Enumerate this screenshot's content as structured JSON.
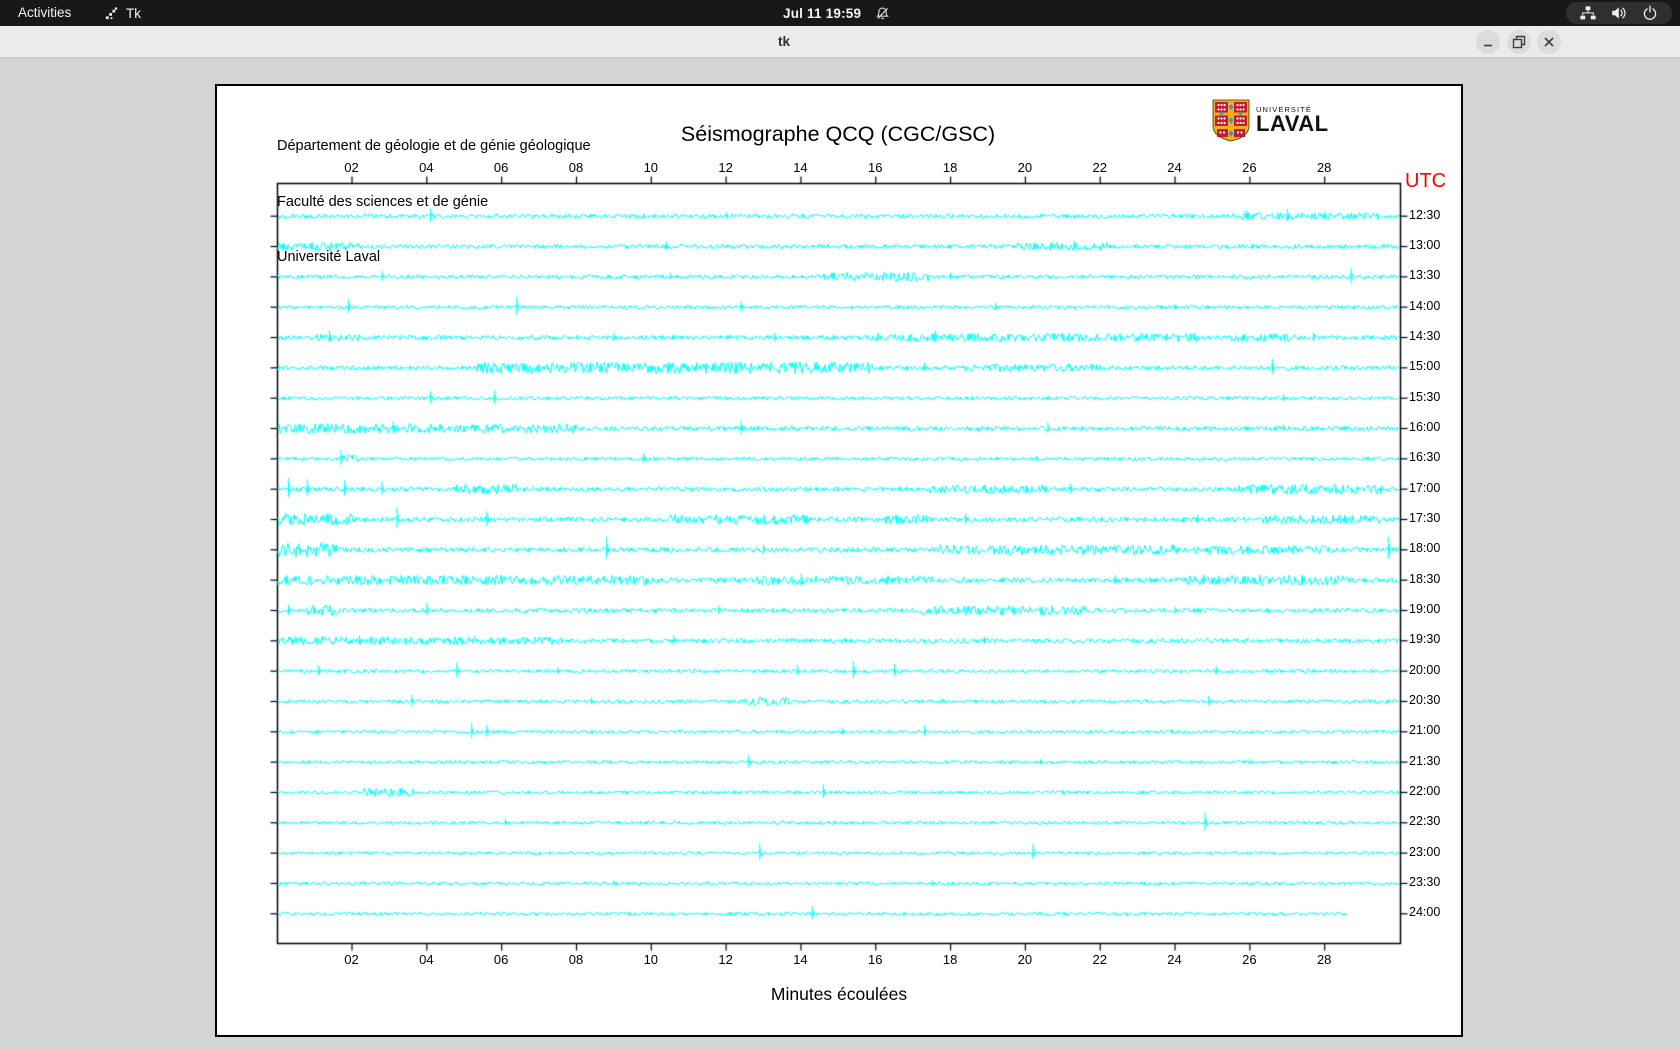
{
  "topbar": {
    "activities": "Activities",
    "app_name": "Tk",
    "clock": "Jul 11 19:59",
    "icons": [
      "tk-icon",
      "notifications-muted-icon",
      "network-wired-icon",
      "volume-icon",
      "power-icon"
    ]
  },
  "titlebar": {
    "title": "tk",
    "buttons": [
      "minimize",
      "maximize",
      "close"
    ]
  },
  "document": {
    "header_lines": [
      "Département de géologie et de génie géologique",
      "Faculté des sciences et de génie",
      "Université Laval"
    ],
    "title": "Séismographe QCQ (CGC/GSC)",
    "utc": "UTC",
    "xlabel": "Minutes écoulées",
    "logo": {
      "line1": "UNIVERSITÉ",
      "line2": "LAVAL"
    }
  },
  "chart_data": {
    "type": "line",
    "subtype": "helicorder-seismograph",
    "title": "Séismographe QCQ (CGC/GSC)",
    "xlabel": "Minutes écoulées",
    "x_range_minutes": [
      0,
      30
    ],
    "x_ticks": [
      "02",
      "04",
      "06",
      "08",
      "10",
      "12",
      "14",
      "16",
      "18",
      "20",
      "22",
      "24",
      "26",
      "28"
    ],
    "ylabel_right": "UTC",
    "trace_color": "#00ffff",
    "axis_color": "#000000",
    "utc_color": "#ff0000",
    "grid": false,
    "rows": [
      {
        "label": "12:30",
        "base": 2.2,
        "end": 30,
        "bursts": [
          [
            25.5,
            29.5,
            1.6
          ]
        ],
        "spikes": [
          [
            4.1,
            8
          ],
          [
            12.0,
            4
          ],
          [
            25.9,
            6
          ],
          [
            27.0,
            7
          ],
          [
            28.0,
            5
          ]
        ]
      },
      {
        "label": "13:00",
        "base": 2.2,
        "end": 30,
        "bursts": [
          [
            0,
            2.2,
            2.0
          ],
          [
            19.8,
            22.2,
            1.9
          ]
        ],
        "spikes": [
          [
            10.4,
            5
          ],
          [
            21.3,
            6
          ]
        ]
      },
      {
        "label": "13:30",
        "base": 2.0,
        "end": 30,
        "bursts": [
          [
            14.6,
            17.4,
            2.3
          ]
        ],
        "spikes": [
          [
            2.8,
            6
          ],
          [
            10.5,
            4
          ],
          [
            18.0,
            4
          ],
          [
            28.7,
            9
          ]
        ]
      },
      {
        "label": "14:00",
        "base": 1.8,
        "end": 30,
        "bursts": [],
        "spikes": [
          [
            1.9,
            8
          ],
          [
            6.4,
            10
          ],
          [
            12.4,
            6
          ],
          [
            19.2,
            4
          ],
          [
            24.0,
            3
          ]
        ]
      },
      {
        "label": "14:30",
        "base": 2.3,
        "end": 30,
        "bursts": [
          [
            1.0,
            2.2,
            1.5
          ],
          [
            15.8,
            24.6,
            1.8
          ],
          [
            25.4,
            27.2,
            1.8
          ]
        ],
        "spikes": [
          [
            1.4,
            7
          ],
          [
            9.0,
            5
          ],
          [
            13.3,
            5
          ],
          [
            17.6,
            7
          ],
          [
            21.0,
            5
          ],
          [
            27.7,
            5
          ]
        ]
      },
      {
        "label": "15:00",
        "base": 2.3,
        "end": 30,
        "bursts": [
          [
            5.2,
            15.9,
            2.5
          ],
          [
            18.4,
            22.0,
            1.7
          ]
        ],
        "spikes": [
          [
            12.4,
            6
          ],
          [
            17.3,
            5
          ],
          [
            26.6,
            9
          ]
        ]
      },
      {
        "label": "15:30",
        "base": 1.8,
        "end": 30,
        "bursts": [],
        "spikes": [
          [
            4.1,
            7
          ],
          [
            5.8,
            8
          ],
          [
            26.9,
            4
          ]
        ]
      },
      {
        "label": "16:00",
        "base": 2.3,
        "end": 30,
        "bursts": [
          [
            0,
            8,
            2.1
          ]
        ],
        "spikes": [
          [
            3.1,
            7
          ],
          [
            12.4,
            8
          ],
          [
            20.6,
            6
          ],
          [
            26.9,
            4
          ]
        ]
      },
      {
        "label": "16:30",
        "base": 1.8,
        "end": 30,
        "bursts": [
          [
            1.7,
            2.2,
            2.2
          ]
        ],
        "spikes": [
          [
            1.7,
            9
          ],
          [
            9.8,
            6
          ],
          [
            20.3,
            3
          ]
        ]
      },
      {
        "label": "17:00",
        "base": 2.3,
        "end": 30,
        "bursts": [
          [
            4.6,
            6.4,
            2.2
          ],
          [
            17.4,
            20.6,
            1.9
          ],
          [
            25.7,
            29.6,
            2.2
          ]
        ],
        "spikes": [
          [
            0.3,
            11
          ],
          [
            0.8,
            10
          ],
          [
            1.8,
            9
          ],
          [
            2.8,
            8
          ],
          [
            21.2,
            6
          ]
        ]
      },
      {
        "label": "17:30",
        "base": 2.5,
        "end": 30,
        "bursts": [
          [
            0,
            2.0,
            2.4
          ],
          [
            10.4,
            14.2,
            2.0
          ],
          [
            16.2,
            17.4,
            1.9
          ],
          [
            26.3,
            29.5,
            1.8
          ]
        ],
        "spikes": [
          [
            3.2,
            12
          ],
          [
            5.6,
            8
          ],
          [
            18.4,
            6
          ],
          [
            24.6,
            5
          ]
        ]
      },
      {
        "label": "18:00",
        "base": 2.5,
        "end": 30,
        "bursts": [
          [
            0,
            1.6,
            2.9
          ],
          [
            17.7,
            24.2,
            2.0
          ],
          [
            24.5,
            28.2,
            1.8
          ]
        ],
        "spikes": [
          [
            8.8,
            13
          ],
          [
            13.0,
            5
          ],
          [
            29.7,
            13
          ]
        ]
      },
      {
        "label": "18:30",
        "base": 2.7,
        "end": 30,
        "bursts": [
          [
            0,
            10,
            1.8
          ],
          [
            12.8,
            17.6,
            1.7
          ],
          [
            24.3,
            28.6,
            1.9
          ]
        ],
        "spikes": [
          [
            14.0,
            6
          ],
          [
            22.4,
            5
          ]
        ]
      },
      {
        "label": "19:00",
        "base": 2.3,
        "end": 30,
        "bursts": [
          [
            0.8,
            1.6,
            2.4
          ],
          [
            17.2,
            21.6,
            2.1
          ]
        ],
        "spikes": [
          [
            0.3,
            6
          ],
          [
            4.0,
            7
          ],
          [
            11.8,
            5
          ],
          [
            24.0,
            4
          ]
        ]
      },
      {
        "label": "19:30",
        "base": 2.3,
        "end": 30,
        "bursts": [
          [
            0,
            7.6,
            1.8
          ]
        ],
        "spikes": [
          [
            2.2,
            5
          ],
          [
            10.6,
            6
          ],
          [
            18.9,
            4
          ]
        ]
      },
      {
        "label": "20:00",
        "base": 1.8,
        "end": 30,
        "bursts": [],
        "spikes": [
          [
            1.1,
            6
          ],
          [
            4.8,
            9
          ],
          [
            7.5,
            4
          ],
          [
            13.9,
            6
          ],
          [
            15.4,
            10
          ],
          [
            16.5,
            7
          ],
          [
            25.1,
            5
          ]
        ]
      },
      {
        "label": "20:30",
        "base": 1.8,
        "end": 30,
        "bursts": [
          [
            12.5,
            13.7,
            2.7
          ]
        ],
        "spikes": [
          [
            3.6,
            7
          ],
          [
            8.4,
            4
          ],
          [
            17.8,
            3
          ],
          [
            24.9,
            6
          ]
        ]
      },
      {
        "label": "21:00",
        "base": 1.7,
        "end": 30,
        "bursts": [],
        "spikes": [
          [
            5.2,
            9
          ],
          [
            5.6,
            7
          ],
          [
            15.1,
            4
          ],
          [
            17.3,
            6
          ],
          [
            23.9,
            3
          ]
        ]
      },
      {
        "label": "21:30",
        "base": 1.7,
        "end": 30,
        "bursts": [],
        "spikes": [
          [
            12.6,
            7
          ],
          [
            20.4,
            3
          ],
          [
            26.0,
            3
          ]
        ]
      },
      {
        "label": "22:00",
        "base": 1.7,
        "end": 30,
        "bursts": [
          [
            2.3,
            3.7,
            2.5
          ]
        ],
        "spikes": [
          [
            14.6,
            8
          ],
          [
            21.0,
            3
          ]
        ]
      },
      {
        "label": "22:30",
        "base": 1.7,
        "end": 30,
        "bursts": [],
        "spikes": [
          [
            6.1,
            4
          ],
          [
            24.8,
            11
          ]
        ]
      },
      {
        "label": "23:00",
        "base": 1.6,
        "end": 30,
        "bursts": [],
        "spikes": [
          [
            12.9,
            10
          ],
          [
            20.2,
            9
          ]
        ]
      },
      {
        "label": "23:30",
        "base": 1.6,
        "end": 30,
        "bursts": [],
        "spikes": [
          [
            9.0,
            3
          ],
          [
            17.5,
            3
          ]
        ]
      },
      {
        "label": "24:00",
        "base": 1.6,
        "end": 28.6,
        "bursts": [],
        "spikes": [
          [
            14.3,
            8
          ]
        ]
      }
    ]
  }
}
